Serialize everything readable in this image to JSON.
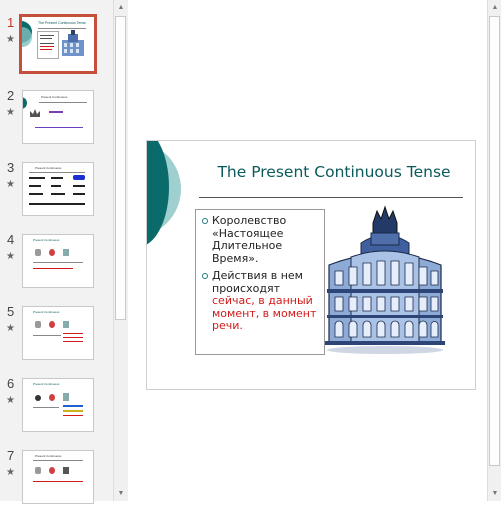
{
  "colors": {
    "accent_teal": "#0b6b6b",
    "accent_teal_light": "#7fbfbf",
    "selected_border": "#c4503b",
    "highlight_red": "#d21a1a"
  },
  "thumbnails": [
    {
      "number": "1",
      "title": "The Present Continuous Tense",
      "active": true,
      "star": "★"
    },
    {
      "number": "2",
      "title": "Present Continuous",
      "active": false,
      "star": "★"
    },
    {
      "number": "3",
      "title": "Present Continuous",
      "active": false,
      "star": "★"
    },
    {
      "number": "4",
      "title": "Present Continuous",
      "active": false,
      "star": "★"
    },
    {
      "number": "5",
      "title": "Present Continuous",
      "active": false,
      "star": "★"
    },
    {
      "number": "6",
      "title": "Present Continuous",
      "active": false,
      "star": "★"
    },
    {
      "number": "7",
      "title": "Present Continuous",
      "active": false,
      "star": "★"
    }
  ],
  "slide": {
    "title": "The Present Continuous Tense",
    "bullet1_lines": [
      "Королевство",
      "«Настоящее",
      "Длительное",
      "Время»."
    ],
    "bullet2_lines_black": [
      "Действия в нем",
      "происходят"
    ],
    "bullet2_lines_red": [
      "сейчас, в данный",
      "момент, в момент",
      "речи."
    ],
    "picture": "building-clipart"
  },
  "icons": {
    "scroll_up": "▲",
    "scroll_down": "▼"
  }
}
